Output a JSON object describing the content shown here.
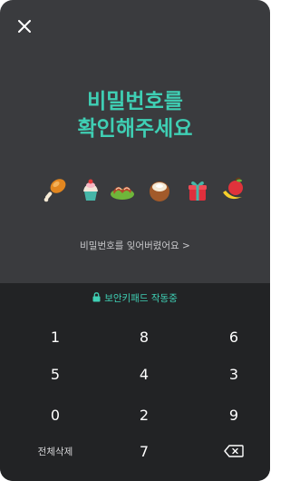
{
  "header": {
    "close_icon": "close-icon"
  },
  "title": {
    "line1": "비밀번호를",
    "line2": "확인해주세요"
  },
  "emojis": [
    "drumstick",
    "cupcake",
    "bacon-lettuce",
    "coconut-dessert",
    "gift",
    "apple-banana"
  ],
  "forgot_link": "비밀번호를 잊어버렸어요 >",
  "keypad": {
    "secure_label": "보안키패드 작동중",
    "rows": [
      [
        "1",
        "8",
        "6"
      ],
      [
        "5",
        "4",
        "3"
      ],
      [
        "0",
        "2",
        "9"
      ],
      [
        "전체삭제",
        "7",
        "backspace-icon"
      ]
    ]
  },
  "colors": {
    "accent": "#3fcfb4",
    "background": "#3a3b3e",
    "keypad_bg": "#222325"
  }
}
